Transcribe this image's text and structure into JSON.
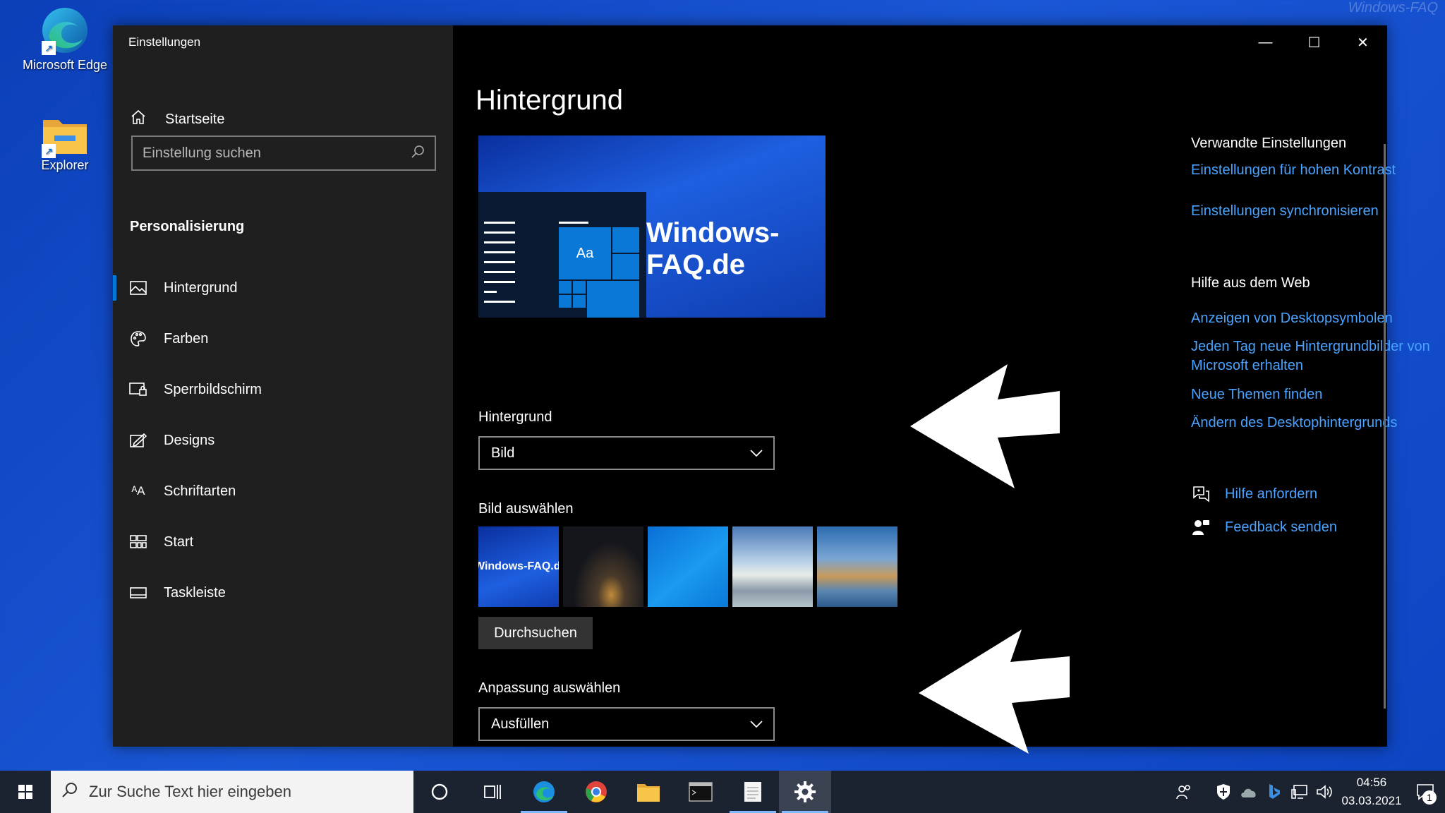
{
  "desktop": {
    "icons": [
      {
        "label": "Microsoft Edge",
        "icon": "edge-icon"
      },
      {
        "label": "Explorer",
        "icon": "folder-icon"
      }
    ],
    "watermark": "Windows-FAQ"
  },
  "window": {
    "title": "Einstellungen",
    "controls": {
      "minimize": "—",
      "maximize": "☐",
      "close": "✕"
    }
  },
  "sidebar": {
    "home": "Startseite",
    "search_placeholder": "Einstellung suchen",
    "section": "Personalisierung",
    "items": [
      {
        "label": "Hintergrund",
        "icon": "image-icon",
        "active": true
      },
      {
        "label": "Farben",
        "icon": "palette-icon"
      },
      {
        "label": "Sperrbildschirm",
        "icon": "lockscreen-icon"
      },
      {
        "label": "Designs",
        "icon": "designs-icon"
      },
      {
        "label": "Schriftarten",
        "icon": "fonts-icon"
      },
      {
        "label": "Start",
        "icon": "start-icon"
      },
      {
        "label": "Taskleiste",
        "icon": "taskbar-icon"
      }
    ]
  },
  "main": {
    "title": "Hintergrund",
    "preview": {
      "tile_text": "Aa",
      "wallpaper_text": "Windows-FAQ.de"
    },
    "background_label": "Hintergrund",
    "background_value": "Bild",
    "choose_image_label": "Bild auswählen",
    "thumbnail_text": "Windows-FAQ.de",
    "browse_button": "Durchsuchen",
    "fit_label": "Anpassung auswählen",
    "fit_value": "Ausfüllen"
  },
  "related": {
    "heading": "Verwandte Einstellungen",
    "links": [
      "Einstellungen für hohen Kontrast",
      "Einstellungen synchronisieren"
    ]
  },
  "web_help": {
    "heading": "Hilfe aus dem Web",
    "links": [
      "Anzeigen von Desktopsymbolen",
      "Jeden Tag neue Hintergrundbilder von Microsoft erhalten",
      "Neue Themen finden",
      "Ändern des Desktophintergrunds"
    ]
  },
  "support": {
    "get_help": "Hilfe anfordern",
    "feedback": "Feedback senden"
  },
  "taskbar": {
    "search_placeholder": "Zur Suche Text hier eingeben",
    "time": "04:56",
    "date": "03.03.2021",
    "notification_count": "1"
  },
  "colors": {
    "accent": "#0078d7",
    "link": "#4aa3ff",
    "sidebar": "#1f1f1f",
    "desktop": "#1a57d6"
  }
}
